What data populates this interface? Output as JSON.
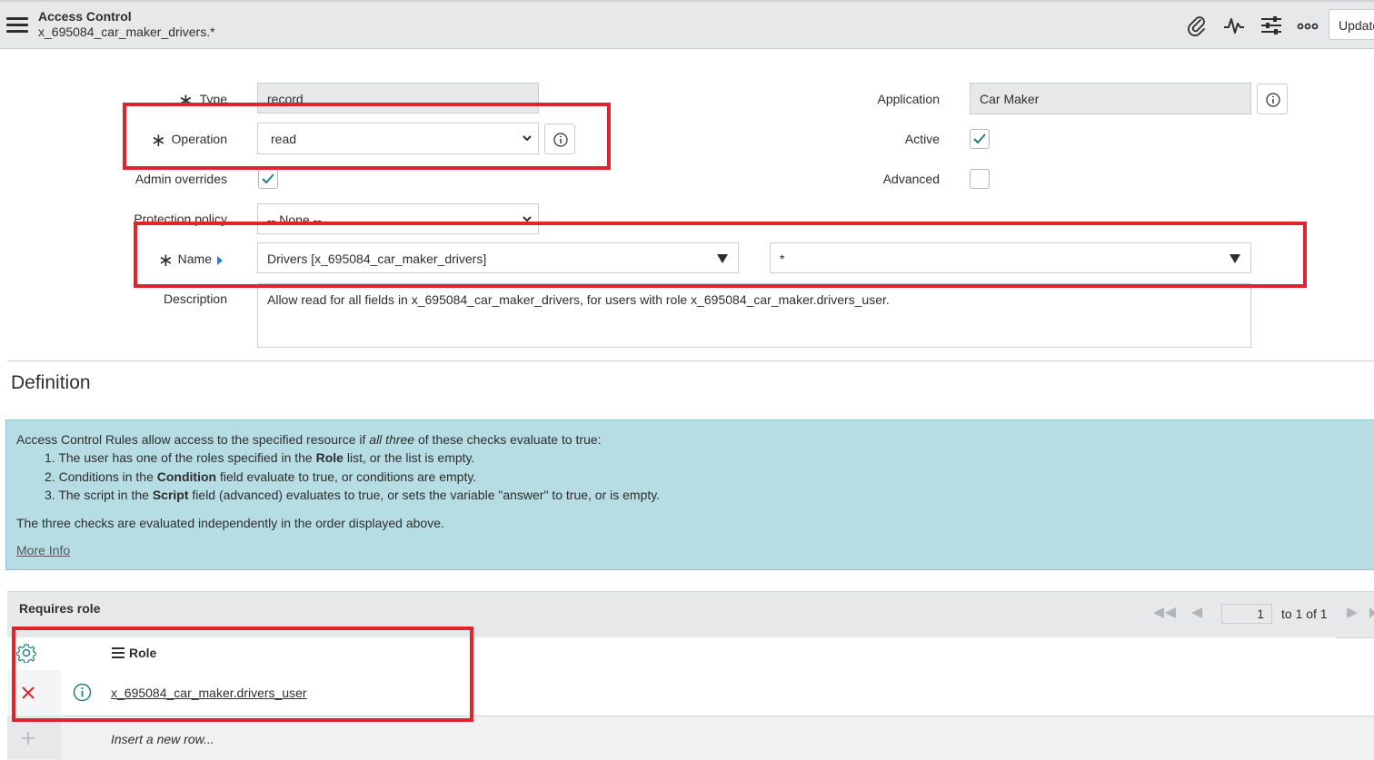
{
  "header": {
    "title": "Access Control",
    "subtitle": "x_695084_car_maker_drivers.*",
    "update_label": "Update"
  },
  "form": {
    "type": {
      "label": "Type",
      "value": "record"
    },
    "operation": {
      "label": "Operation",
      "value": "read"
    },
    "admin_overrides": {
      "label": "Admin overrides",
      "checked": true
    },
    "protection_policy": {
      "label": "Protection policy",
      "value": "-- None --"
    },
    "name": {
      "label": "Name",
      "table_value": "Drivers [x_695084_car_maker_drivers]",
      "field_value": "*"
    },
    "description": {
      "label": "Description",
      "value": "Allow read for all fields in x_695084_car_maker_drivers, for users with role x_695084_car_maker.drivers_user."
    },
    "application": {
      "label": "Application",
      "value": "Car Maker"
    },
    "active": {
      "label": "Active",
      "checked": true
    },
    "advanced": {
      "label": "Advanced",
      "checked": false
    }
  },
  "definition": {
    "heading": "Definition",
    "intro_before": "Access Control Rules allow access to the specified resource if ",
    "intro_em": "all three",
    "intro_after": " of these checks evaluate to true:",
    "items": [
      {
        "num": "1.",
        "before": "The user has one of the roles specified in the ",
        "bold": "Role",
        "after": " list, or the list is empty."
      },
      {
        "num": "2.",
        "before": "Conditions in the ",
        "bold": "Condition",
        "after": " field evaluate to true, or conditions are empty."
      },
      {
        "num": "3.",
        "before": "The script in the ",
        "bold": "Script",
        "after": " field (advanced) evaluates to true, or sets the variable \"answer\" to true, or is empty."
      }
    ],
    "note": "The three checks are evaluated independently in the order displayed above.",
    "more_info": "More Info"
  },
  "related_list": {
    "title": "Requires role",
    "column": "Role",
    "pager_page": "1",
    "pager_text": "to 1 of 1",
    "rows": [
      {
        "role": "x_695084_car_maker.drivers_user"
      }
    ],
    "insert_text": "Insert a new row..."
  },
  "colors": {
    "highlight": "#e0242c",
    "info_panel": "#b5dde3",
    "check": "#1f8476"
  }
}
